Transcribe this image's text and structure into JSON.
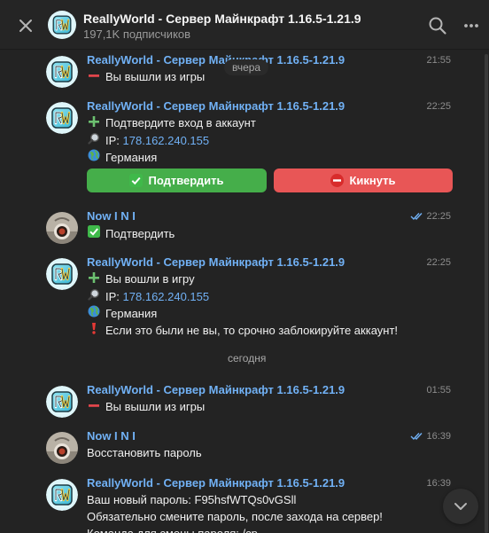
{
  "header": {
    "title": "ReallyWorld - Сервер Майнкрафт 1.16.5-1.21.9",
    "subscribers": "197,1K подписчиков"
  },
  "dates": {
    "yesterday": "вчера",
    "today": "сегодня"
  },
  "messages": [
    {
      "sender": "ReallyWorld - Сервер Майнкрафт 1.16.5-1.21.9",
      "time": "21:55",
      "lines": [
        "Вы вышли из игры"
      ]
    },
    {
      "sender": "ReallyWorld - Сервер Майнкрафт 1.16.5-1.21.9",
      "time": "22:25",
      "lines": [
        "Подтвердите вход в аккаунт",
        "IP:",
        "Германия"
      ],
      "ip": "178.162.240.155",
      "buttons": [
        "Подтвердить",
        "Кикнуть"
      ]
    },
    {
      "sender": "Now I N I",
      "time": "22:25",
      "lines": [
        "Подтвердить"
      ]
    },
    {
      "sender": "ReallyWorld - Сервер Майнкрафт 1.16.5-1.21.9",
      "time": "22:25",
      "lines": [
        "Вы вошли в игру",
        "IP:",
        "Германия",
        "Если это были не вы, то срочно заблокируйте аккаунт!"
      ],
      "ip": "178.162.240.155"
    },
    {
      "sender": "ReallyWorld - Сервер Майнкрафт 1.16.5-1.21.9",
      "time": "01:55",
      "lines": [
        "Вы вышли из игры"
      ]
    },
    {
      "sender": "Now I N I",
      "time": "16:39",
      "lines": [
        "Восстановить пароль"
      ]
    },
    {
      "sender": "ReallyWorld - Сервер Майнкрафт 1.16.5-1.21.9",
      "time": "16:39",
      "lines": [
        "Ваш новый пароль: F95hsfWTQs0vGSll",
        "Обязательно смените пароль, после захода на сервер!",
        "Команда для смены пароля: /cp"
      ]
    }
  ],
  "colors": {
    "accent": "#71b1f5",
    "confirm_button": "#45ae4a",
    "kick_button": "#e85656",
    "check_emoji": "#3fb94a",
    "minus_emoji": "#e0454b",
    "plus_emoji": "#6cc070"
  },
  "icons": {
    "close": "close-icon",
    "search": "search-icon",
    "more": "more-vertical-icon",
    "read": "double-check-icon",
    "scroll_down": "chevron-down-icon"
  }
}
